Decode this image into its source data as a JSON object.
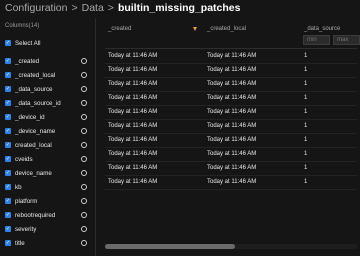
{
  "breadcrumb": {
    "items": [
      "Configuration",
      "Data",
      "builtin_missing_patches"
    ],
    "separator": ">"
  },
  "sidebar": {
    "columns_label": "Columns(14)",
    "select_all_label": "Select All",
    "columns": [
      {
        "label": "_created",
        "checked": true
      },
      {
        "label": "_created_local",
        "checked": true
      },
      {
        "label": "_data_source",
        "checked": true
      },
      {
        "label": "_data_source_id",
        "checked": true
      },
      {
        "label": "_device_id",
        "checked": true
      },
      {
        "label": "_device_name",
        "checked": true
      },
      {
        "label": "created_local",
        "checked": true
      },
      {
        "label": "cveids",
        "checked": true
      },
      {
        "label": "device_name",
        "checked": true
      },
      {
        "label": "kb",
        "checked": true
      },
      {
        "label": "platform",
        "checked": true
      },
      {
        "label": "rebootrequired",
        "checked": true
      },
      {
        "label": "severity",
        "checked": true
      },
      {
        "label": "title",
        "checked": true
      }
    ]
  },
  "grid": {
    "headers": [
      "_created",
      "_created_local",
      "_data_source"
    ],
    "sorted_column": "_created",
    "sort_direction": "descending",
    "filter": {
      "min_placeholder": "min",
      "max_placeholder": "max"
    },
    "rows": [
      [
        "Today at 11:46 AM",
        "Today at 11:46 AM",
        "1"
      ],
      [
        "Today at 11:46 AM",
        "Today at 11:46 AM",
        "1"
      ],
      [
        "Today at 11:46 AM",
        "Today at 11:46 AM",
        "1"
      ],
      [
        "Today at 11:46 AM",
        "Today at 11:46 AM",
        "1"
      ],
      [
        "Today at 11:46 AM",
        "Today at 11:46 AM",
        "1"
      ],
      [
        "Today at 11:46 AM",
        "Today at 11:46 AM",
        "1"
      ],
      [
        "Today at 11:46 AM",
        "Today at 11:46 AM",
        "1"
      ],
      [
        "Today at 11:46 AM",
        "Today at 11:46 AM",
        "1"
      ],
      [
        "Today at 11:46 AM",
        "Today at 11:46 AM",
        "1"
      ],
      [
        "Today at 11:46 AM",
        "Today at 11:46 AM",
        "1"
      ]
    ]
  },
  "colors": {
    "accent": "#2f80ed",
    "sort_indicator": "#e0a040",
    "background": "#151515"
  }
}
